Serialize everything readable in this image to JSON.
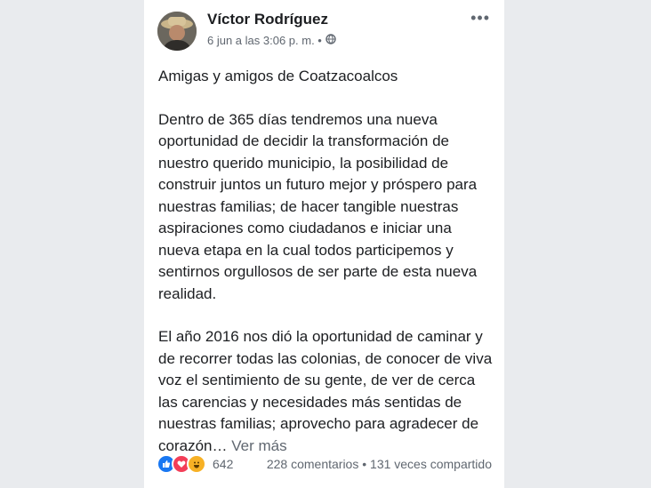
{
  "post": {
    "author": "Víctor Rodríguez",
    "meta": "6 jun a las 3:06 p. m. •",
    "privacy_icon": "globe-icon",
    "more_label": "•••",
    "paragraphs": [
      "Amigas y amigos de Coatzacoalcos",
      "Dentro de 365 días tendremos una nueva oportunidad de decidir la transformación de nuestro querido municipio, la posibilidad de construir juntos un futuro mejor y próspero para nuestras familias; de hacer tangible nuestras aspiraciones como ciudadanos e iniciar una nueva etapa en la cual todos participemos y sentirnos orgullosos de ser parte de esta nueva realidad.",
      "El año 2016 nos dió la oportunidad de caminar y de recorrer todas las colonias, de conocer de viva voz el sentimiento de su gente, de ver de cerca las carencias y necesidades más sentidas de nuestras familias; aprovecho para agradecer de corazón…"
    ],
    "see_more": "Ver más"
  },
  "footer": {
    "reaction_icons": [
      "like-icon",
      "love-icon",
      "haha-icon"
    ],
    "reaction_count": "642",
    "stats": "228 comentarios • 131 veces compartido"
  },
  "colors": {
    "text": "#1c1e21",
    "secondary": "#606770",
    "like": "#1877f2",
    "love": "#f33e58",
    "haha": "#f7b125"
  }
}
